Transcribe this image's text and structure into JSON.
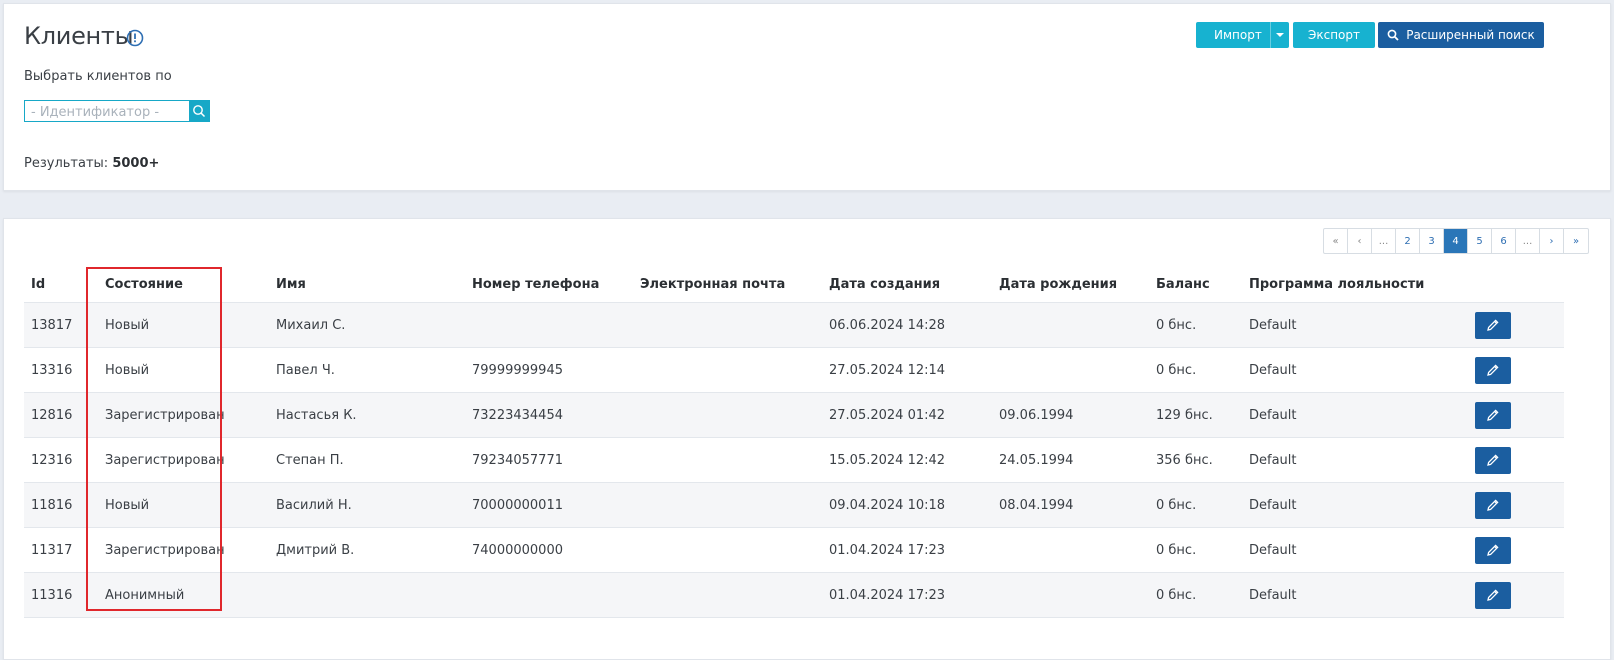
{
  "header": {
    "title": "Клиенты",
    "filter_label": "Выбрать клиентов по",
    "search_placeholder": "- Идентификатор -",
    "results_label": "Результаты:",
    "results_value": "5000+"
  },
  "actions": {
    "import_label": "Импорт",
    "export_label": "Экспорт",
    "advanced_search_label": "Расширенный поиск"
  },
  "pagination": {
    "items": [
      "«",
      "‹",
      "...",
      "2",
      "3",
      "4",
      "5",
      "6",
      "...",
      "›",
      "»"
    ],
    "active": "4"
  },
  "table": {
    "columns": [
      "Id",
      "Состояние",
      "Имя",
      "Номер телефона",
      "Электронная почта",
      "Дата создания",
      "Дата рождения",
      "Баланс",
      "Программа лояльности"
    ],
    "rows": [
      {
        "id": "13817",
        "state": "Новый",
        "name": "Михаил С.",
        "phone": "",
        "email": "",
        "created": "06.06.2024 14:28",
        "birth": "",
        "balance": "0 бнс.",
        "loyalty": "Default"
      },
      {
        "id": "13316",
        "state": "Новый",
        "name": "Павел Ч.",
        "phone": "79999999945",
        "email": "",
        "created": "27.05.2024 12:14",
        "birth": "",
        "balance": "0 бнс.",
        "loyalty": "Default"
      },
      {
        "id": "12816",
        "state": "Зарегистрирован",
        "name": "Настасья К.",
        "phone": "73223434454",
        "email": "",
        "created": "27.05.2024 01:42",
        "birth": "09.06.1994",
        "balance": "129 бнс.",
        "loyalty": "Default"
      },
      {
        "id": "12316",
        "state": "Зарегистрирован",
        "name": "Степан П.",
        "phone": "79234057771",
        "email": "",
        "created": "15.05.2024 12:42",
        "birth": "24.05.1994",
        "balance": "356 бнс.",
        "loyalty": "Default"
      },
      {
        "id": "11816",
        "state": "Новый",
        "name": "Василий Н.",
        "phone": "70000000011",
        "email": "",
        "created": "09.04.2024 10:18",
        "birth": "08.04.1994",
        "balance": "0 бнс.",
        "loyalty": "Default"
      },
      {
        "id": "11317",
        "state": "Зарегистрирован",
        "name": "Дмитрий В.",
        "phone": "74000000000",
        "email": "",
        "created": "01.04.2024 17:23",
        "birth": "",
        "balance": "0 бнс.",
        "loyalty": "Default"
      },
      {
        "id": "11316",
        "state": "Анонимный",
        "name": "",
        "phone": "",
        "email": "",
        "created": "01.04.2024 17:23",
        "birth": "",
        "balance": "0 бнс.",
        "loyalty": "Default"
      }
    ]
  },
  "colors": {
    "accent_teal": "#17b2d0",
    "primary_blue": "#1b5ea0",
    "highlight_red": "#e0272c"
  },
  "icons": {
    "info": "info-icon",
    "search": "search-icon",
    "edit": "pencil-icon",
    "dropdown": "chevron-down-icon"
  }
}
